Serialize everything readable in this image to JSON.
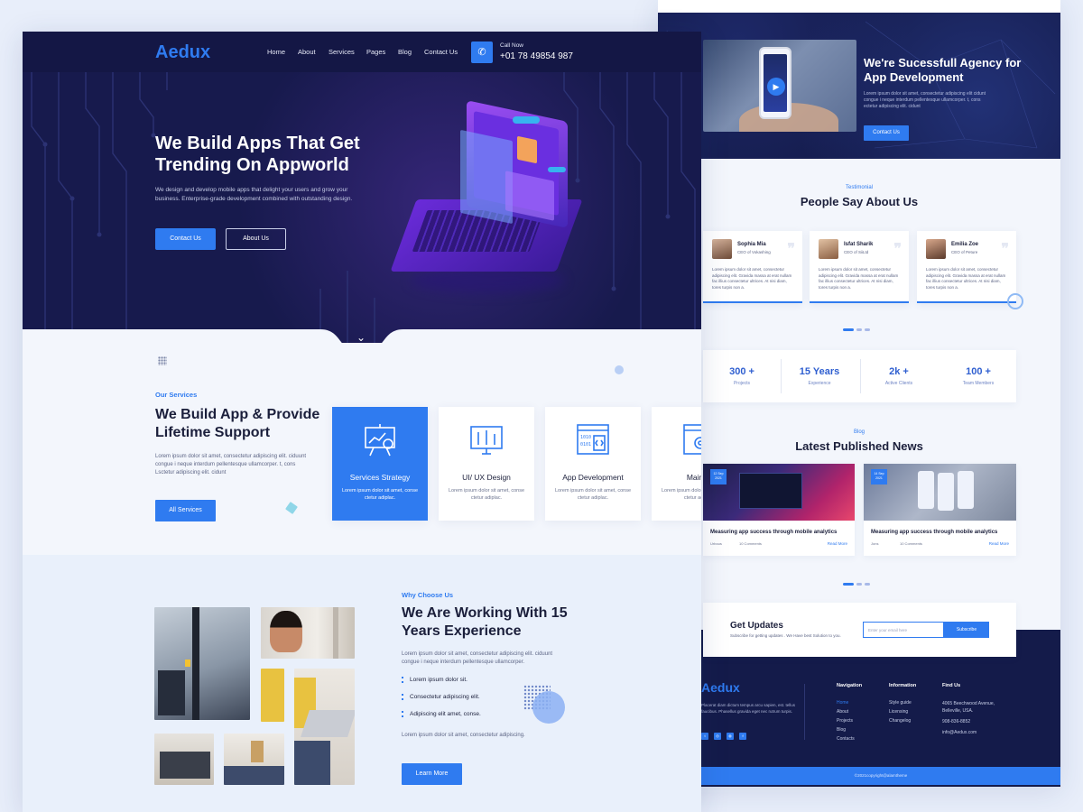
{
  "colors": {
    "accent": "#2f7bf0",
    "navy": "#141745",
    "hero": "#171a4d",
    "text": "#1b1f3b",
    "muted": "#5d6585",
    "page": "#e8eefa"
  },
  "landing": {
    "nav": {
      "logo": "Aedux",
      "items": [
        "Home",
        "About",
        "Services",
        "Pages",
        "Blog",
        "Contact Us"
      ],
      "call_label": "Call Now",
      "call_number": "+01 78 49854 987",
      "call_icon": "phone-icon"
    },
    "hero": {
      "title": "We Build Apps That Get Trending On Appworld",
      "text": "We design and develop mobile apps that delight your users and grow your business. Enterprise-grade development combined with outstanding design.",
      "primary_button": "Contact Us",
      "secondary_button": "About Us",
      "scroll_icon": "chevron-down-icon"
    },
    "services": {
      "tag": "Our Services",
      "title": "We Build App & Provide Lifetime Support",
      "text": "Lorem ipsum dolor sit amet, consectetur adipiscing elit. ciduunt congue i neque interdum pellentesque ullamcorper. t, cons Lsctetur adipiscing elit. cidunt",
      "button": "All Services",
      "cards": [
        {
          "title": "Services Strategy",
          "text": "Lorem ipsum dolor sit amet, conse ctetur adiplac.",
          "icon": "presentation-board-icon",
          "active": true
        },
        {
          "title": "UI/ UX Design",
          "text": "Lorem ipsum dolor sit amet, conse ctetur adiplac.",
          "icon": "design-tools-icon",
          "active": false
        },
        {
          "title": "App Development",
          "text": "Lorem ipsum dolor sit amet, conse ctetur adiplac.",
          "icon": "code-screen-icon",
          "active": false
        },
        {
          "title": "Mainter",
          "text": "Lorem ipsum dolor sit amet, conse ctetur adiplac.",
          "icon": "settings-window-icon",
          "active": false
        }
      ]
    },
    "why": {
      "tag": "Why Choose Us",
      "title": "We Are Working With 15 Years Experience",
      "text": "Lorem ipsum dolor sit amet, consectetur adipiscing elit. ciduunt congue i neque interdum pellentesque ullamcorper.",
      "items": [
        "Lorem ipsum dolor sit.",
        "Consectetur adipiscing elit.",
        "Adipiscing elit amet, conse."
      ],
      "footnote": "Lorem ipsum dolor sit amet, consectetur adipiscing.",
      "button": "Learn More"
    }
  },
  "detail": {
    "hero": {
      "title": "We're Sucessfull Agency for App Development",
      "text": "Lorem ipsum dolor sit amet, consectetur adipiscing elit cidunt congue i neque interdum pellentesque ullamcorper. t, cons ectetur adipiscing elit. cidunt",
      "button": "Contact Us",
      "play_icon": "play-icon"
    },
    "testimonials": {
      "tag": "Testimonial",
      "title": "People Say About Us",
      "items": [
        {
          "name": "Sophia Mia",
          "role": "CEO of Vokashing",
          "text": "Lorem ipsum dolor sit amet, consectetur adipiscing elit. Gravida massa at erat nullam fac illius consectetur ultrices. At nisi diam, tores turpis non a."
        },
        {
          "name": "Isfat Sharik",
          "role": "CEO of SiiLtd",
          "text": "Lorem ipsum dolor sit amet, consectetur adipiscing elit. Gravida massa at erat nullam fac illius consectetur ultrices. At nisi diam, tores turpis non a."
        },
        {
          "name": "Emilia Zoe",
          "role": "CEO of Peture",
          "text": "Lorem ipsum dolor sit amet, consectetur adipiscing elit. Gravida massa at erat nullam fac illius consectetur ultrices. At nisi diam, tores turpis non a."
        }
      ]
    },
    "stats": [
      {
        "value": "300 +",
        "label": "Projects"
      },
      {
        "value": "15 Years",
        "label": "Experience"
      },
      {
        "value": "2k +",
        "label": "Active Clients"
      },
      {
        "value": "100 +",
        "label": "Team Members"
      }
    ],
    "blog": {
      "tag": "Blog",
      "title": "Latest  Published News",
      "posts": [
        {
          "date": "12 Sep 2021",
          "title": "Measuring app success through mobile analytics",
          "author": "Urbous",
          "comments": "10 Comments",
          "more": "Read More"
        },
        {
          "date": "14 Sep 2021",
          "title": "Measuring app success through mobile analytics",
          "author": "Jons",
          "comments": "10 Comments",
          "more": "Read More"
        }
      ]
    },
    "updates": {
      "title": "Get Updates",
      "subtitle": "Subscribe for getting updates . We Have best Solution to you.",
      "placeholder": "Enter your email here",
      "button": "Subscribe"
    },
    "footer": {
      "logo": "Aedux",
      "text": "Placerat diam dictum tempus arcu sapien, est. tellus faucibus. Phasellus gravida eget nec rutrum turpis.",
      "social": [
        "twitter-icon",
        "instagram-icon",
        "dribbble-icon",
        "facebook-icon"
      ],
      "columns": [
        {
          "heading": "Navigation",
          "links": [
            "Home",
            "About",
            "Projects",
            "Blog",
            "Contacts"
          ]
        },
        {
          "heading": "Information",
          "links": [
            "Style guide",
            "Licensing",
            "Changelog"
          ]
        },
        {
          "heading": "Find Us",
          "links": [
            "4065 Beechwood Avenue, Belleville, USA.",
            "908-836-8852",
            "info@Aedux.com"
          ]
        }
      ],
      "copyright": "©2021copyright@alamtheme"
    }
  }
}
